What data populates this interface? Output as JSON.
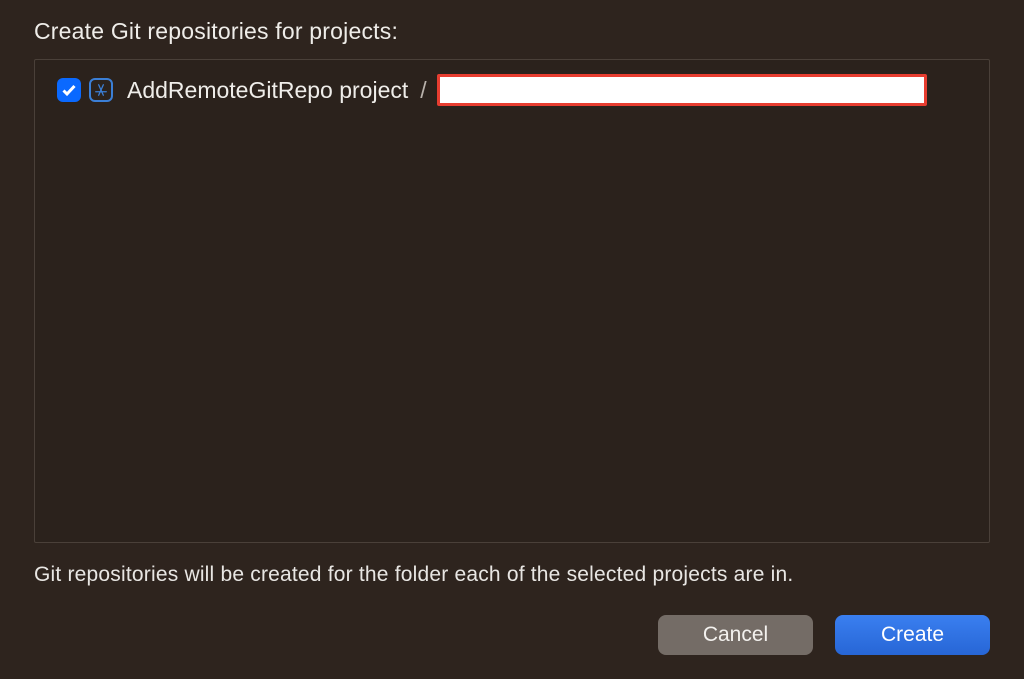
{
  "dialog": {
    "heading": "Create Git repositories for projects:",
    "info": "Git repositories will be created for the folder each of the selected projects are in.",
    "buttons": {
      "cancel": "Cancel",
      "create": "Create"
    }
  },
  "projects": [
    {
      "checked": true,
      "name": "AddRemoteGitRepo project",
      "separator": "/",
      "path": ""
    }
  ],
  "colors": {
    "background": "#2e241e",
    "accent": "#0a69ff",
    "highlight_border": "#e73d30",
    "primary_button": "#2f72e2"
  }
}
